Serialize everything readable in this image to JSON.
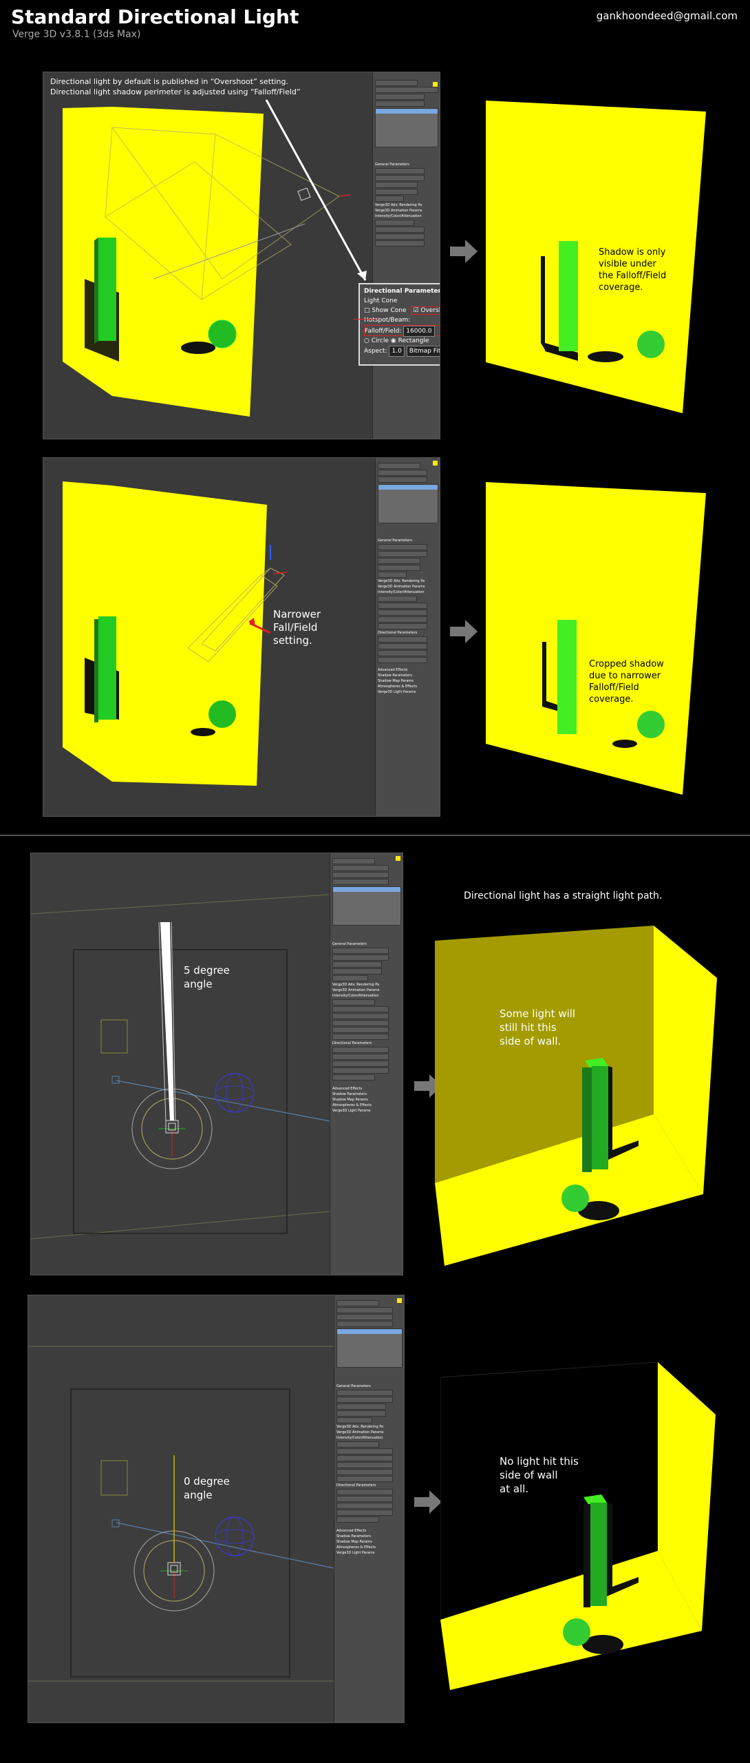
{
  "header": {
    "title": "Standard Directional Light",
    "subtitle": "Verge 3D v3.8.1 (3ds Max)",
    "email": "gankhoondeed@gmail.com"
  },
  "section1": {
    "note_line1": "Directional light by default is published in “Overshoot” setting.",
    "note_line2": "Directional light shadow perimeter is adjusted using “Falloff/Field”",
    "dir_params": {
      "title": "Directional Parameters",
      "light_cone": "Light Cone",
      "show_cone": "Show Cone",
      "overshoot": "Overshoot",
      "hotspot": "Hotspot/Beam:",
      "falloff": "Falloff/Field:",
      "falloff_value": "16000.0",
      "circle": "Circle",
      "rectangle": "Rectangle",
      "aspect": "Aspect:",
      "aspect_value": "1.0",
      "bitmap_fit": "Bitmap Fit..."
    },
    "result_caption": [
      "Shadow is only",
      "visible under",
      "the Falloff/Field",
      "coverage."
    ]
  },
  "section2": {
    "annotation": [
      "Narrower",
      "Fall/Field",
      "setting."
    ],
    "result_caption": [
      "Cropped shadow",
      "due to narrower",
      "Falloff/Field",
      "coverage."
    ]
  },
  "section3": {
    "angle_label": [
      "5 degree",
      "angle"
    ],
    "heading": "Directional light has a straight light path.",
    "result_caption": [
      "Some light will",
      "still hit this",
      "side of wall."
    ]
  },
  "section4": {
    "angle_label": [
      "0 degree",
      "angle"
    ],
    "result_caption": [
      "No light hit this",
      "side of wall",
      "at all."
    ]
  },
  "colors": {
    "wall_yellow": "#ffff00",
    "dim_yellow": "#a39b00",
    "box_green": "#22cc22",
    "annotation_red": "#e02020"
  }
}
